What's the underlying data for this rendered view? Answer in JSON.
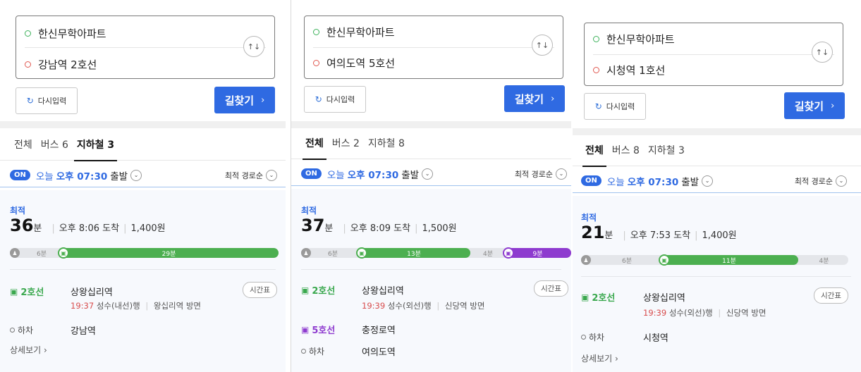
{
  "common": {
    "swap_glyph": "↑↓",
    "reset_label": "다시입력",
    "reset_icon_glyph": "↻",
    "search_label": "길찾기",
    "search_arrow": "›",
    "on_badge": "ON",
    "today": "오늘",
    "time": "오후 07:30",
    "depart": "출발",
    "sort_label": "최적 경로순",
    "chevron_glyph": "⌄",
    "best_label": "최적",
    "minute_unit": "분",
    "timetable_label": "시간표",
    "alight_label": "하차",
    "detail_label": "상세보기",
    "detail_arrow": "›",
    "train_glyph": "▣",
    "walk_glyph": "♟",
    "divider_glyph": "|",
    "colors": {
      "accent": "#2f6ae2",
      "line2": "#3db24b",
      "line5": "#8e3bcf",
      "depart_time": "#d84c4c"
    }
  },
  "panels": [
    {
      "origin": "한신무학아파트",
      "destination": "강남역 2호선",
      "tabs": [
        "전체",
        "버스 6",
        "지하철 3"
      ],
      "active_tab": 2,
      "result": {
        "minutes": "36",
        "arrival": "오후 8:06 도착",
        "fare": "1,400원",
        "segments": [
          {
            "type": "walk",
            "label": "6분",
            "minutes": 6
          },
          {
            "type": "line2",
            "label": "29분",
            "minutes": 29
          }
        ],
        "steps": [
          {
            "line": "2호선",
            "station": "상왕십리역",
            "depart_time": "19:37",
            "direction": "성수(내선)행",
            "platform": "왕십리역 방면"
          }
        ],
        "alight_station": "강남역",
        "show_detail": true
      }
    },
    {
      "origin": "한신무학아파트",
      "destination": "여의도역 5호선",
      "tabs": [
        "전체",
        "버스 2",
        "지하철 8"
      ],
      "active_tab": 0,
      "result": {
        "minutes": "37",
        "arrival": "오후 8:09 도착",
        "fare": "1,500원",
        "segments": [
          {
            "type": "walk",
            "label": "6분",
            "minutes": 6
          },
          {
            "type": "line2",
            "label": "13분",
            "minutes": 13
          },
          {
            "type": "walk",
            "label": "4분",
            "minutes": 4
          },
          {
            "type": "line5",
            "label": "9분",
            "minutes": 9
          }
        ],
        "steps": [
          {
            "line": "2호선",
            "station": "상왕십리역",
            "depart_time": "19:39",
            "direction": "성수(외선)행",
            "platform": "신당역 방면"
          },
          {
            "line": "5호선",
            "station": "충정로역"
          }
        ],
        "alight_station": "여의도역",
        "show_detail": false
      }
    },
    {
      "origin": "한신무학아파트",
      "destination": "시청역 1호선",
      "tabs": [
        "전체",
        "버스 8",
        "지하철 3"
      ],
      "active_tab": 0,
      "result": {
        "minutes": "21",
        "arrival": "오후 7:53 도착",
        "fare": "1,400원",
        "segments": [
          {
            "type": "walk",
            "label": "6분",
            "minutes": 6
          },
          {
            "type": "line2",
            "label": "11분",
            "minutes": 11
          },
          {
            "type": "walk",
            "label": "4분",
            "minutes": 4
          }
        ],
        "steps": [
          {
            "line": "2호선",
            "station": "상왕십리역",
            "depart_time": "19:39",
            "direction": "성수(외선)행",
            "platform": "신당역 방면"
          }
        ],
        "alight_station": "시청역",
        "show_detail": true
      }
    }
  ]
}
